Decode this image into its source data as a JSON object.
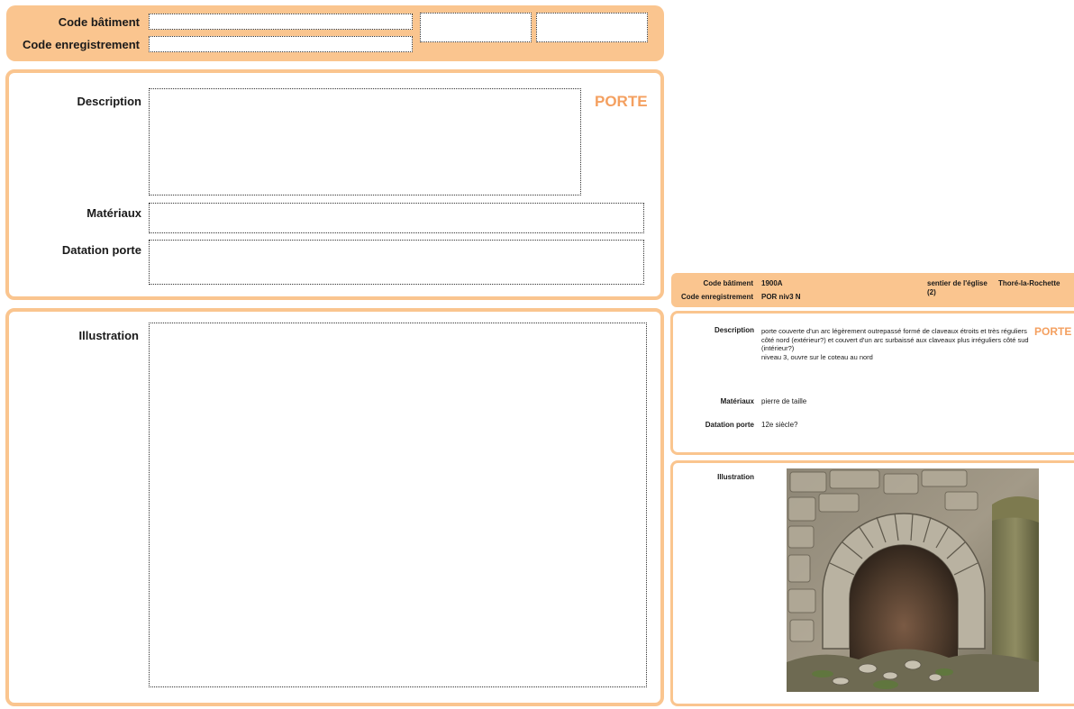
{
  "form": {
    "labels": {
      "code_batiment": "Code bâtiment",
      "code_enregistrement": "Code enregistrement",
      "description": "Description",
      "materiaux": "Matériaux",
      "datation": "Datation porte",
      "illustration": "Illustration"
    },
    "type_title": "PORTE",
    "fields": {
      "code_batiment": "",
      "code_enregistrement": "",
      "extra_1": "",
      "extra_2": "",
      "description": "",
      "materiaux": "",
      "datation": ""
    }
  },
  "preview": {
    "labels": {
      "code_batiment": "Code bâtiment",
      "code_enregistrement": "Code enregistrement",
      "description": "Description",
      "materiaux": "Matériaux",
      "datation": "Datation porte",
      "illustration": "Illustration"
    },
    "type_title": "PORTE",
    "code_batiment": "1900A",
    "code_enregistrement": "POR niv3 N",
    "lieu": "sentier de l'église\n(2)",
    "commune": "Thoré-la-Rochette",
    "description": "porte couverte d'un arc légèrement outrepassé formé de claveaux étroits et très réguliers côté nord (extérieur?) et couvert d'un arc surbaissé aux claveaux plus irréguliers côté sud (intérieur?)\nniveau 3, ouvre sur le coteau au nord",
    "materiaux": "pierre de taille",
    "datation": "12e siècle?",
    "photo_icon": "stone-arch-photo"
  },
  "colors": {
    "accent_fill": "#fac58f",
    "accent_text": "#f4a060"
  }
}
